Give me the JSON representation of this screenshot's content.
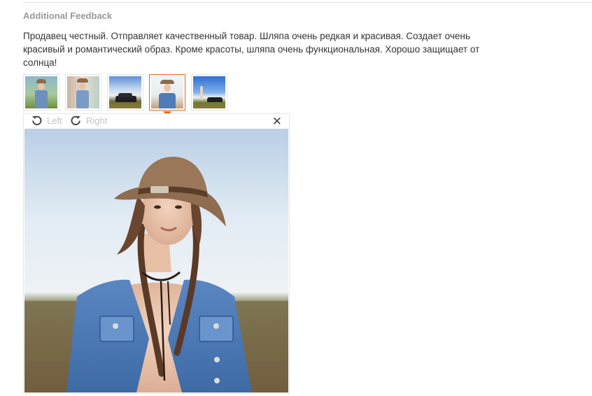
{
  "section": {
    "title": "Additional Feedback",
    "text": "Продавец честный. Отправляет качественный товар. Шляпа очень редкая и красивая. Создает очень красивый и романтический образ. Кроме красоты, шляпа очень функциональная. Хорошо защищает от солнца!"
  },
  "thumbnails": [
    {
      "subject": "woman-in-hat-field"
    },
    {
      "subject": "woman-in-hat-portrait"
    },
    {
      "subject": "black-suv-on-road"
    },
    {
      "subject": "woman-in-hat-denim-vest",
      "selected": true
    },
    {
      "subject": "woman-and-suv-blue-sky"
    }
  ],
  "viewer": {
    "rotate_left_label": "Left",
    "rotate_right_label": "Right",
    "close_icon": "close-icon",
    "image_subject": "woman in brown cowboy hat and denim vest in a field"
  },
  "colors": {
    "accent": "#e8651e",
    "muted_text": "#999999",
    "disabled_text": "#c4c4c4"
  }
}
